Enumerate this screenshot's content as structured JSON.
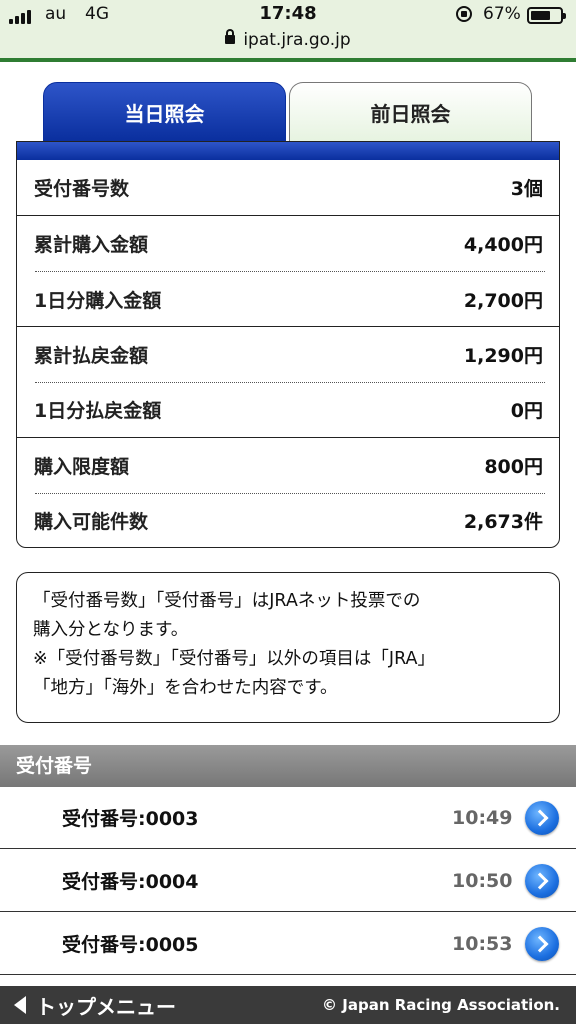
{
  "status_bar": {
    "carrier": "au",
    "network": "4G",
    "time": "17:48",
    "battery_pct": "67%",
    "battery_level": 0.67,
    "url": "ipat.jra.go.jp"
  },
  "tabs": [
    {
      "label": "当日照会",
      "active": true
    },
    {
      "label": "前日照会",
      "active": false
    }
  ],
  "summary": [
    {
      "label": "受付番号数",
      "value": "3個"
    },
    {
      "label": "累計購入金額",
      "value": "4,400円"
    },
    {
      "label": "1日分購入金額",
      "value": "2,700円"
    },
    {
      "label": "累計払戻金額",
      "value": "1,290円"
    },
    {
      "label": "1日分払戻金額",
      "value": "0円"
    },
    {
      "label": "購入限度額",
      "value": "800円"
    },
    {
      "label": "購入可能件数",
      "value": "2,673件"
    }
  ],
  "note": {
    "line1": "「受付番号数」「受付番号」はJRAネット投票での",
    "line2": "購入分となります。",
    "line3": "※「受付番号数」「受付番号」以外の項目は「JRA」",
    "line4": "「地方」「海外」を合わせた内容です。"
  },
  "receipts": {
    "header": "受付番号",
    "items": [
      {
        "label": "受付番号:0003",
        "time": "10:49"
      },
      {
        "label": "受付番号:0004",
        "time": "10:50"
      },
      {
        "label": "受付番号:0005",
        "time": "10:53"
      }
    ]
  },
  "footer": {
    "back_label": "トップメニュー",
    "copyright": "© Japan Racing Association."
  },
  "colors": {
    "tab_active": "#0a2f9e",
    "status_accent": "#2f7d32",
    "arrow_button": "#1c6fe0"
  }
}
